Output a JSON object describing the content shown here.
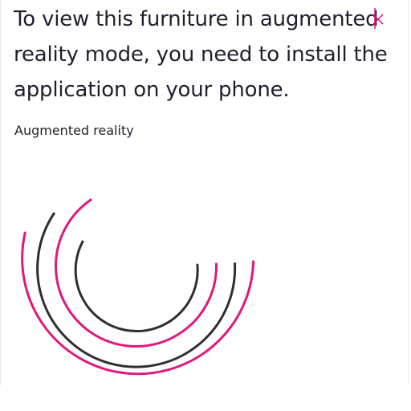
{
  "dialog": {
    "message": "To view this furniture in augmented reality mode, you need to install the application on your phone.",
    "subtitle": "Augmented reality"
  },
  "icons": {
    "close": "close-icon",
    "illustration": "augmented-reality-arcs-icon"
  },
  "colors": {
    "text": "#1f1f2e",
    "accent": "#e0187c",
    "arc_dark": "#2e2e33",
    "close_mark": "#e0187c"
  }
}
